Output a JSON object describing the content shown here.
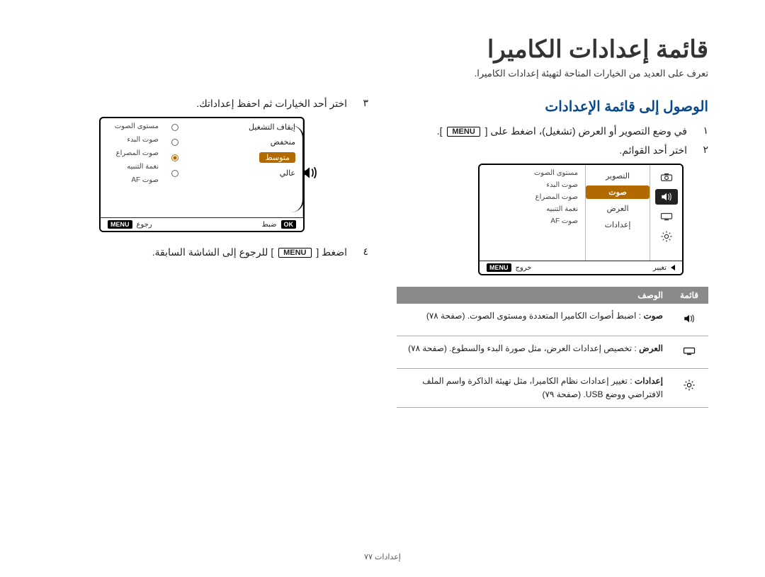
{
  "page": {
    "title": "قائمة إعدادات الكاميرا",
    "subtitle": "تعرف على العديد من الخيارات المتاحة لتهيئة إعدادات الكاميرا.",
    "footer": "إعدادات  ٧٧"
  },
  "right": {
    "heading": "الوصول إلى قائمة الإعدادات",
    "step1_num": "١",
    "step1_a": "في وضع التصوير أو العرض (تشغيل)، اضغط على [",
    "step1_menu": "MENU",
    "step1_b": "].",
    "step2_num": "٢",
    "step2": "اختر أحد القوائم.",
    "lcd": {
      "tabs": {
        "capture": "camera",
        "sound": "speaker",
        "display": "display",
        "settings": "gear"
      },
      "active_tab": "sound",
      "list": [
        "التصوير",
        "صوت",
        "العرض",
        "إعدادات"
      ],
      "selected": "صوت",
      "info": [
        "مستوى الصوت",
        "صوت البدء",
        "صوت المصراع",
        "نغمة التنبيه",
        "صوت AF"
      ],
      "footer_change": "تغيير",
      "footer_exit": "خروج",
      "footer_exit_key": "MENU"
    },
    "table": {
      "head_menu": "قائمة",
      "head_desc": "الوصف",
      "rows": [
        {
          "icon": "speaker",
          "bold": "صوت",
          "text": ": اضبط أصوات الكاميرا المتعددة ومستوى الصوت. (صفحة ٧٨)"
        },
        {
          "icon": "display",
          "bold": "العرض",
          "text": " : تخصيص إعدادات العرض، مثل صورة البدء والسطوع. (صفحة ٧٨)"
        },
        {
          "icon": "gear",
          "bold": "إعدادات",
          "text": ": تغيير إعدادات نظام الكاميرا، مثل تهيئة الذاكرة واسم الملف الافتراضي ووضع USB. (صفحة ٧٩)"
        }
      ]
    }
  },
  "left": {
    "step3_num": "٣",
    "step3": "اختر أحد الخيارات ثم احفظ إعداداتك.",
    "lcd": {
      "options": [
        {
          "label": "إيقاف التشغيل",
          "checked": false
        },
        {
          "label": "منخفض",
          "checked": false
        },
        {
          "label": "متوسط",
          "checked": true
        },
        {
          "label": "عالي",
          "checked": false
        }
      ],
      "info": [
        "مستوى الصوت",
        "صوت البدء",
        "صوت المصراع",
        "نغمة التنبيه",
        "صوت AF"
      ],
      "footer_set": "ضبط",
      "footer_set_key": "OK",
      "footer_back": "رجوع",
      "footer_back_key": "MENU"
    },
    "step4_num": "٤",
    "step4_a": "اضغط [",
    "step4_menu": "MENU",
    "step4_b": "] للرجوع إلى الشاشة السابقة."
  }
}
